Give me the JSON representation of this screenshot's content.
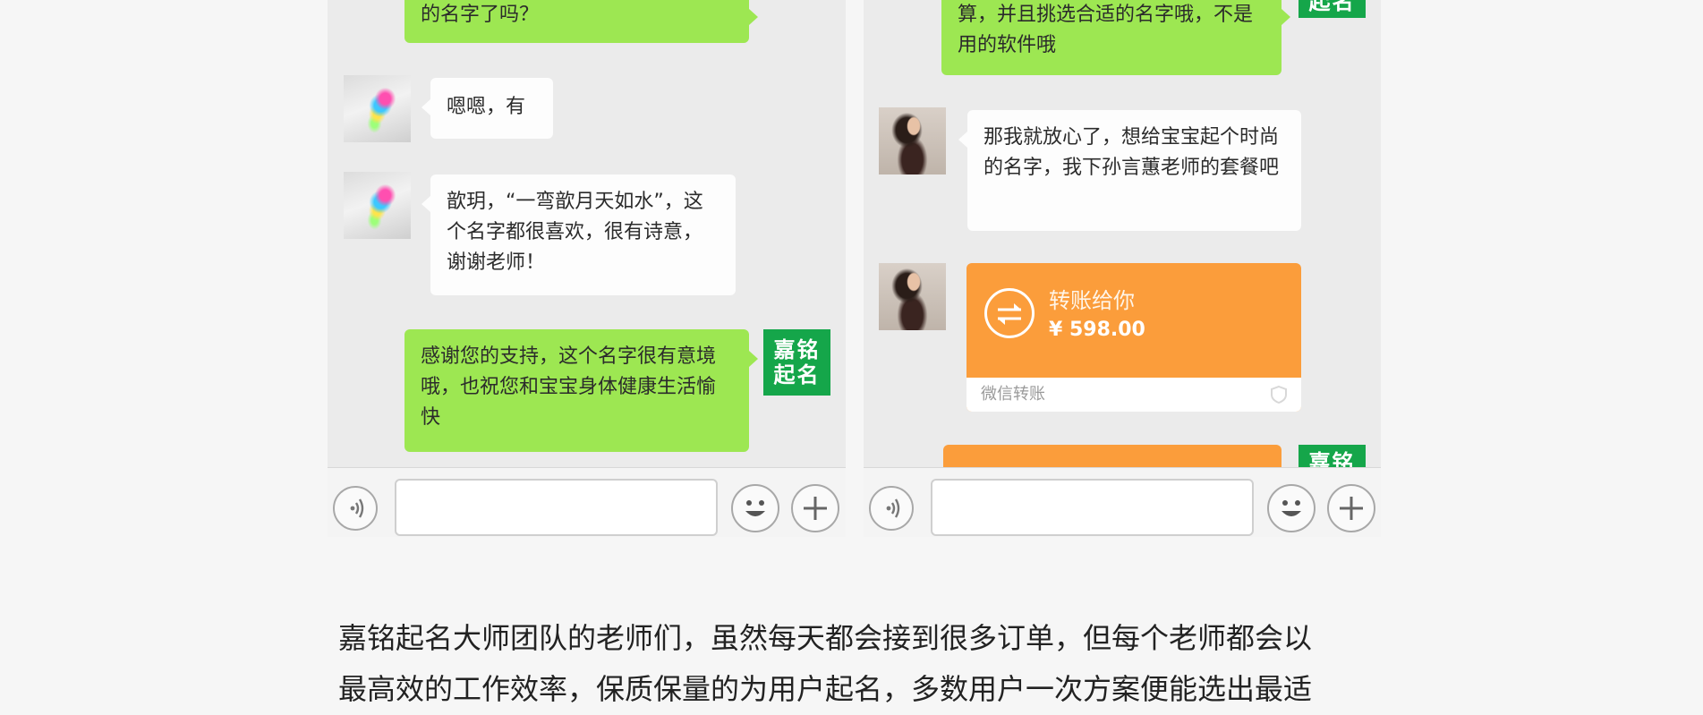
{
  "left_chat": {
    "messages": [
      {
        "text": "的名字了吗？"
      },
      {
        "text": "嗯嗯，有"
      },
      {
        "text": "歆玥，“一弯歆月天如水”，这个名字都很喜欢，很有诗意，谢谢老师！"
      },
      {
        "text": "感谢您的支持，这个名字很有意境哦，也祝您和宝宝身体健康生活愉快"
      }
    ],
    "brand_avatar": {
      "line1": "嘉铭",
      "line2": "起名"
    }
  },
  "right_chat": {
    "messages": [
      {
        "text": "算，并且挑选合适的名字哦，不是用的软件哦"
      },
      {
        "text": "那我就放心了，想给宝宝起个时尚的名字，我下孙言蕙老师的套餐吧"
      }
    ],
    "brand_avatar_top": "起名",
    "brand_avatar_bottom": "嘉铭",
    "transfer": {
      "title": "转账给你",
      "amount": "¥ 598.00",
      "footer": "微信转账"
    }
  },
  "article": {
    "line1": "嘉铭起名大师团队的老师们，虽然每天都会接到很多订单，但每个老师都会以",
    "line2": "最高效的工作效率，保质保量的为用户起名，多数用户一次方案便能选出最适"
  },
  "colors": {
    "green_bubble": "#9de752",
    "white_bubble": "#fdfdfd",
    "transfer_orange": "#fb9d3b",
    "brand_green": "#15a64a",
    "chat_bg": "#ebebeb"
  },
  "icons": [
    "voice-icon",
    "emoji-icon",
    "plus-icon",
    "transfer-arrows-icon",
    "shield-icon"
  ]
}
